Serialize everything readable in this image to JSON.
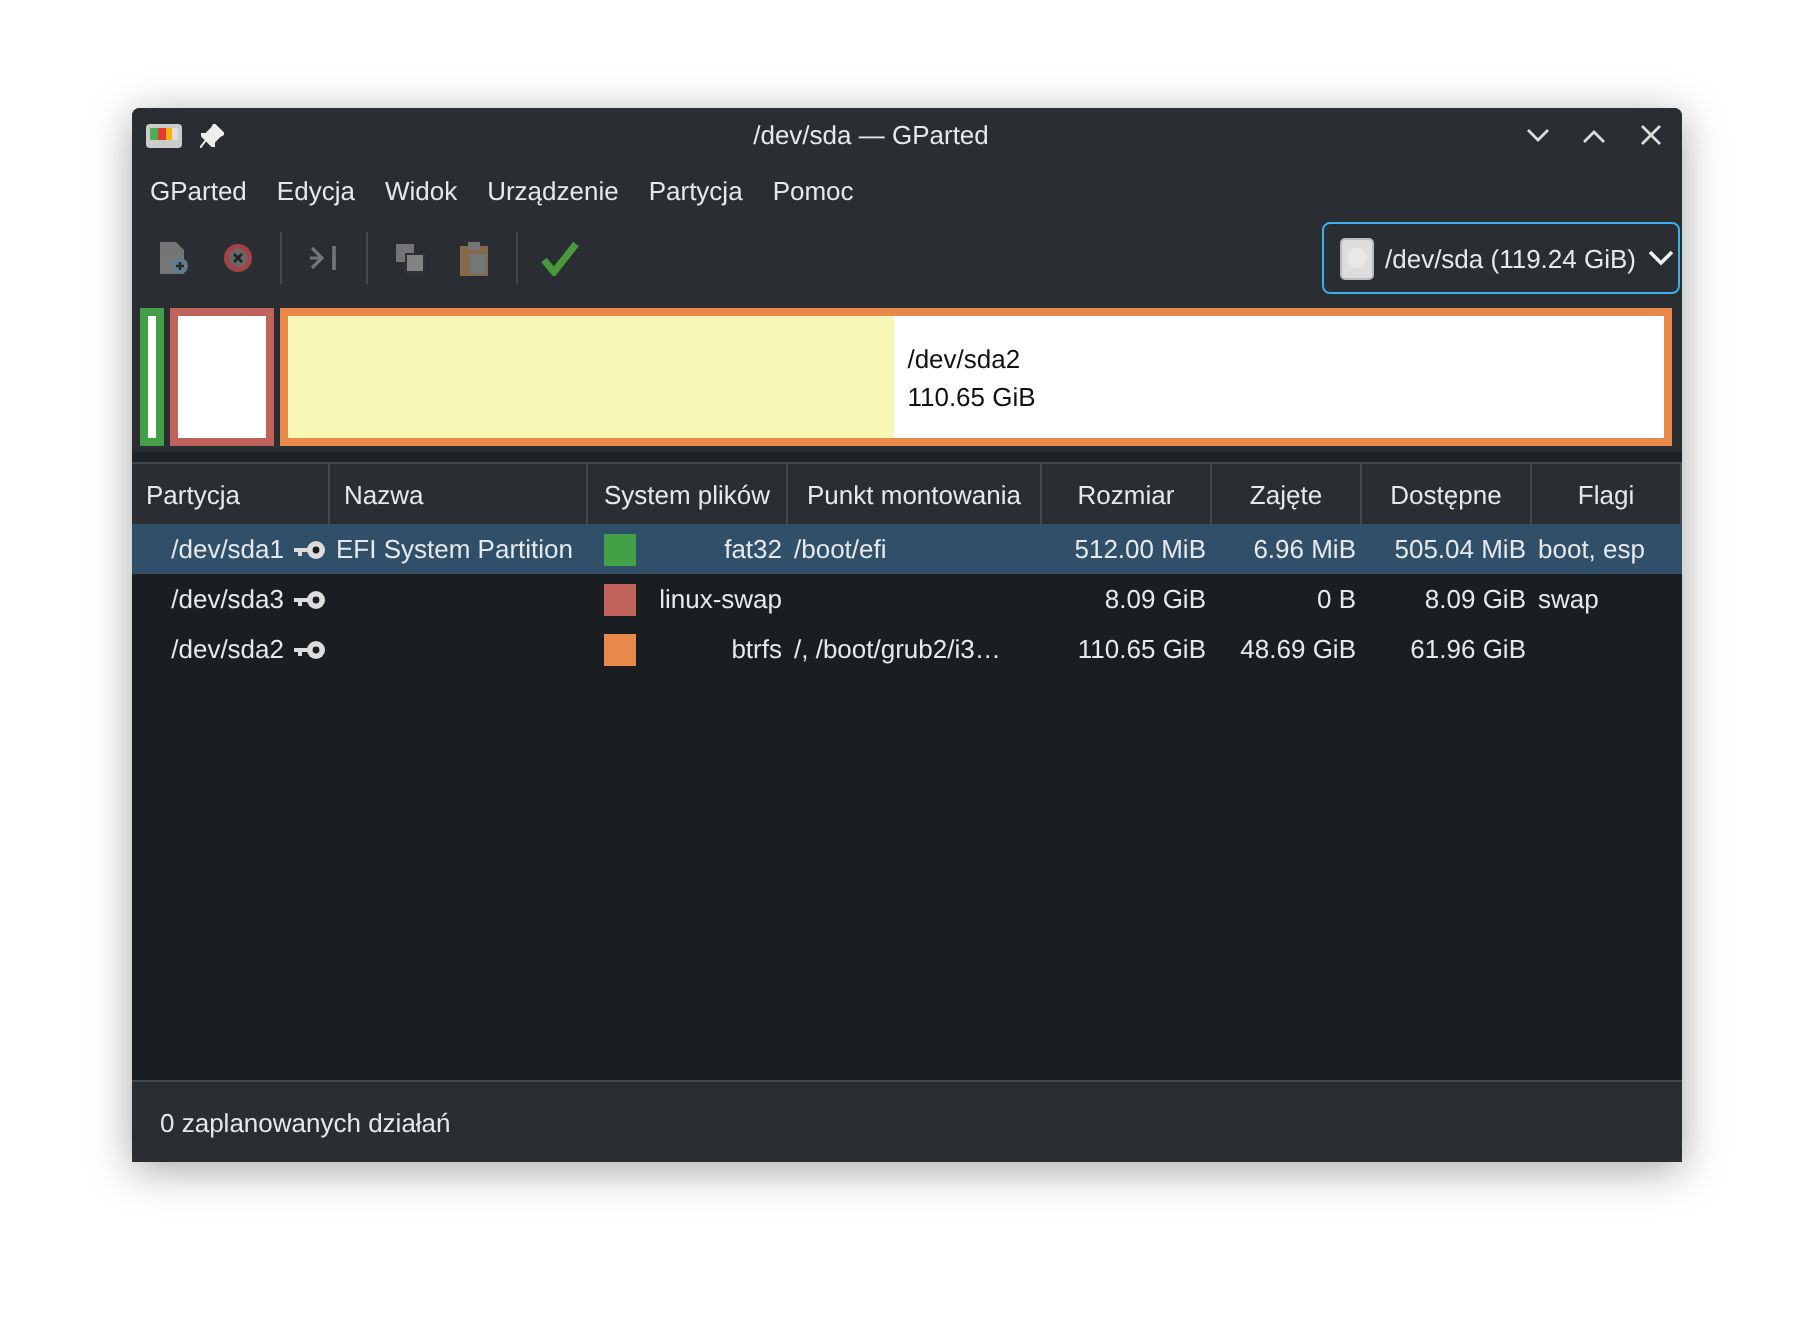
{
  "window": {
    "title": "/dev/sda — GParted"
  },
  "menu": [
    "GParted",
    "Edycja",
    "Widok",
    "Urządzenie",
    "Partycja",
    "Pomoc"
  ],
  "toolbar": [
    {
      "kind": "new",
      "disabled": true
    },
    {
      "kind": "delete",
      "disabled": true
    },
    {
      "kind": "sep"
    },
    {
      "kind": "resize",
      "disabled": true
    },
    {
      "kind": "sep"
    },
    {
      "kind": "copy",
      "disabled": true
    },
    {
      "kind": "paste",
      "disabled": true
    },
    {
      "kind": "sep"
    },
    {
      "kind": "apply",
      "disabled": false
    }
  ],
  "device": {
    "label": "/dev/sda (119.24 GiB)"
  },
  "disk_map": [
    {
      "kind": "sliver",
      "color": "#43a047"
    },
    {
      "kind": "narrow",
      "color": "#c0635b"
    },
    {
      "kind": "wide",
      "color": "#e8894a",
      "level": 0.44,
      "name": "/dev/sda2",
      "size": "110.65 GiB"
    }
  ],
  "table": {
    "columns": [
      "Partycja",
      "Nazwa",
      "System plików",
      "Punkt montowania",
      "Rozmiar",
      "Zajęte",
      "Dostępne",
      "Flagi"
    ],
    "rows": [
      {
        "partition": "/dev/sda1",
        "name": "EFI System Partition",
        "color": "#43a047",
        "filesystem": "fat32",
        "mount": "/boot/efi",
        "size": "512.00 MiB",
        "used": "6.96 MiB",
        "free": "505.04 MiB",
        "flags": "boot, esp",
        "selected": true
      },
      {
        "partition": "/dev/sda3",
        "color": "#c0635b",
        "filesystem": "linux-swap",
        "size": "8.09 GiB",
        "used": "0 B",
        "free": "8.09 GiB",
        "flags": "swap",
        "selected": false
      },
      {
        "partition": "/dev/sda2",
        "color": "#e8894a",
        "filesystem": "btrfs",
        "mount": "/, /boot/grub2/i3…",
        "size": "110.65 GiB",
        "used": "48.69 GiB",
        "free": "61.96 GiB",
        "selected": false
      }
    ]
  },
  "status_bar": "0 zaplanowanych działań"
}
